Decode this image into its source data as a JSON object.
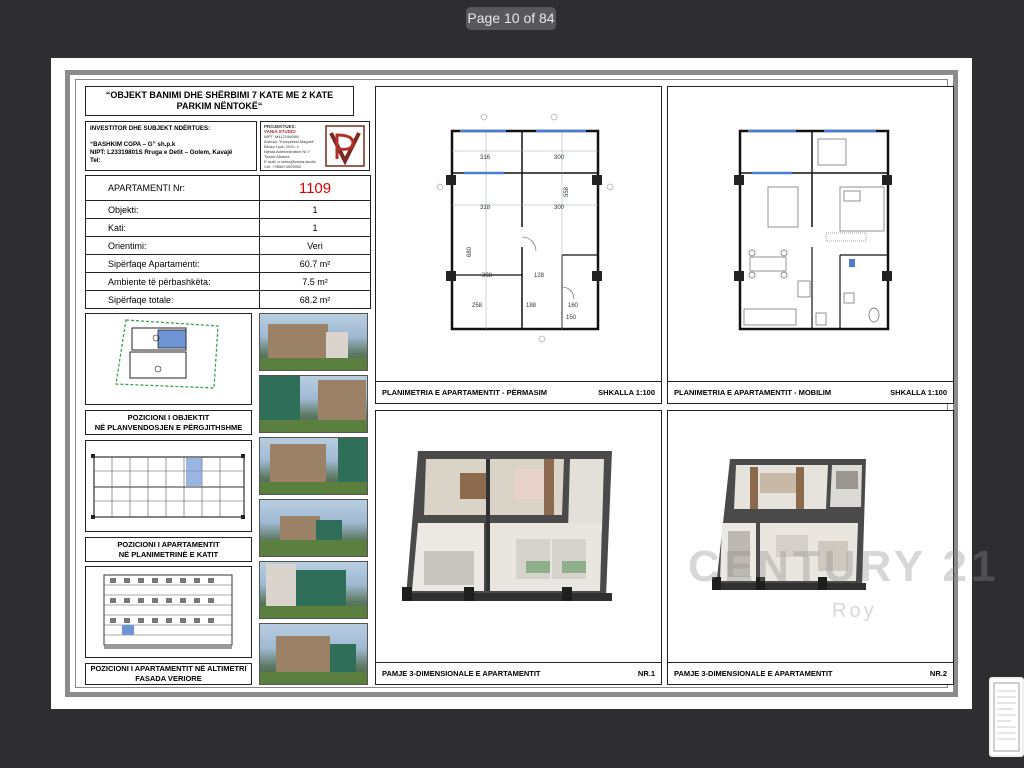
{
  "viewer": {
    "page_indicator": "Page 10 of 84"
  },
  "header": {
    "title": "“OBJEKT BANIMI DHE SHËRBIMI 7 KATE ME 2 KATE PARKIM NËNTOKË“"
  },
  "investor": {
    "heading": "INVESTITOR DHE SUBJEKT NDËRTUES:",
    "name": "“BASHKIM COPA – G” sh.p.k",
    "nipt": "NIPT: L23319801S Rruga e Detit – Golem, Kavajë",
    "tel": "Tel:"
  },
  "designer": {
    "heading": "PROJEKTUES:",
    "name": "VANIA STUDIO",
    "lines": [
      "NIPT: M41219809N",
      "Adresa: “Kompleksi Magnet”,",
      "Blloku Lyon 2010, 1",
      "Njesia Administrative Nr.7",
      "Tiranë Albania",
      "E-mail: a.lusha@vania.studio",
      "Cel: +355674009092"
    ]
  },
  "info_table": [
    {
      "label": "APARTAMENTI Nr:",
      "value": "1109"
    },
    {
      "label": "Objekti:",
      "value": "1"
    },
    {
      "label": "Kati:",
      "value": "1"
    },
    {
      "label": "Orientimi:",
      "value": "Veri"
    },
    {
      "label": "Sipërfaqe Apartamenti:",
      "value": "60.7 m²"
    },
    {
      "label": "Ambiente të përbashkëta:",
      "value": "7.5 m²"
    },
    {
      "label": "Sipërfaqe totale:",
      "value": "68.2 m²"
    }
  ],
  "captions": {
    "position_object": [
      "POZICIONI I OBJEKTIT",
      "NË PLANVENDOSJEN E PËRGJITHSHME"
    ],
    "position_floor": [
      "POZICIONI I APARTAMENTIT",
      "NË PLANIMETRINË E KATIT"
    ],
    "position_facade": [
      "POZICIONI I APARTAMENTIT NË ALTIMETRI",
      "FASADA VERIORE"
    ]
  },
  "panels": [
    {
      "label": "PLANIMETRIA E APARTAMENTIT - PËRMASIM",
      "tag": "SHKALLA 1:100"
    },
    {
      "label": "PLANIMETRIA E APARTAMENTIT - MOBILIM",
      "tag": "SHKALLA 1:100"
    },
    {
      "label": "PAMJE 3-DIMENSIONALE E APARTAMENTIT",
      "tag": "NR.1"
    },
    {
      "label": "PAMJE 3-DIMENSIONALE E APARTAMENTIT",
      "tag": "NR.2"
    }
  ],
  "dims": [
    "316",
    "300",
    "318",
    "300",
    "558",
    "680",
    "308",
    "128",
    "258",
    "188",
    "160",
    "150"
  ],
  "watermark": {
    "brand": "CENTURY 21",
    "office": "Roy"
  }
}
